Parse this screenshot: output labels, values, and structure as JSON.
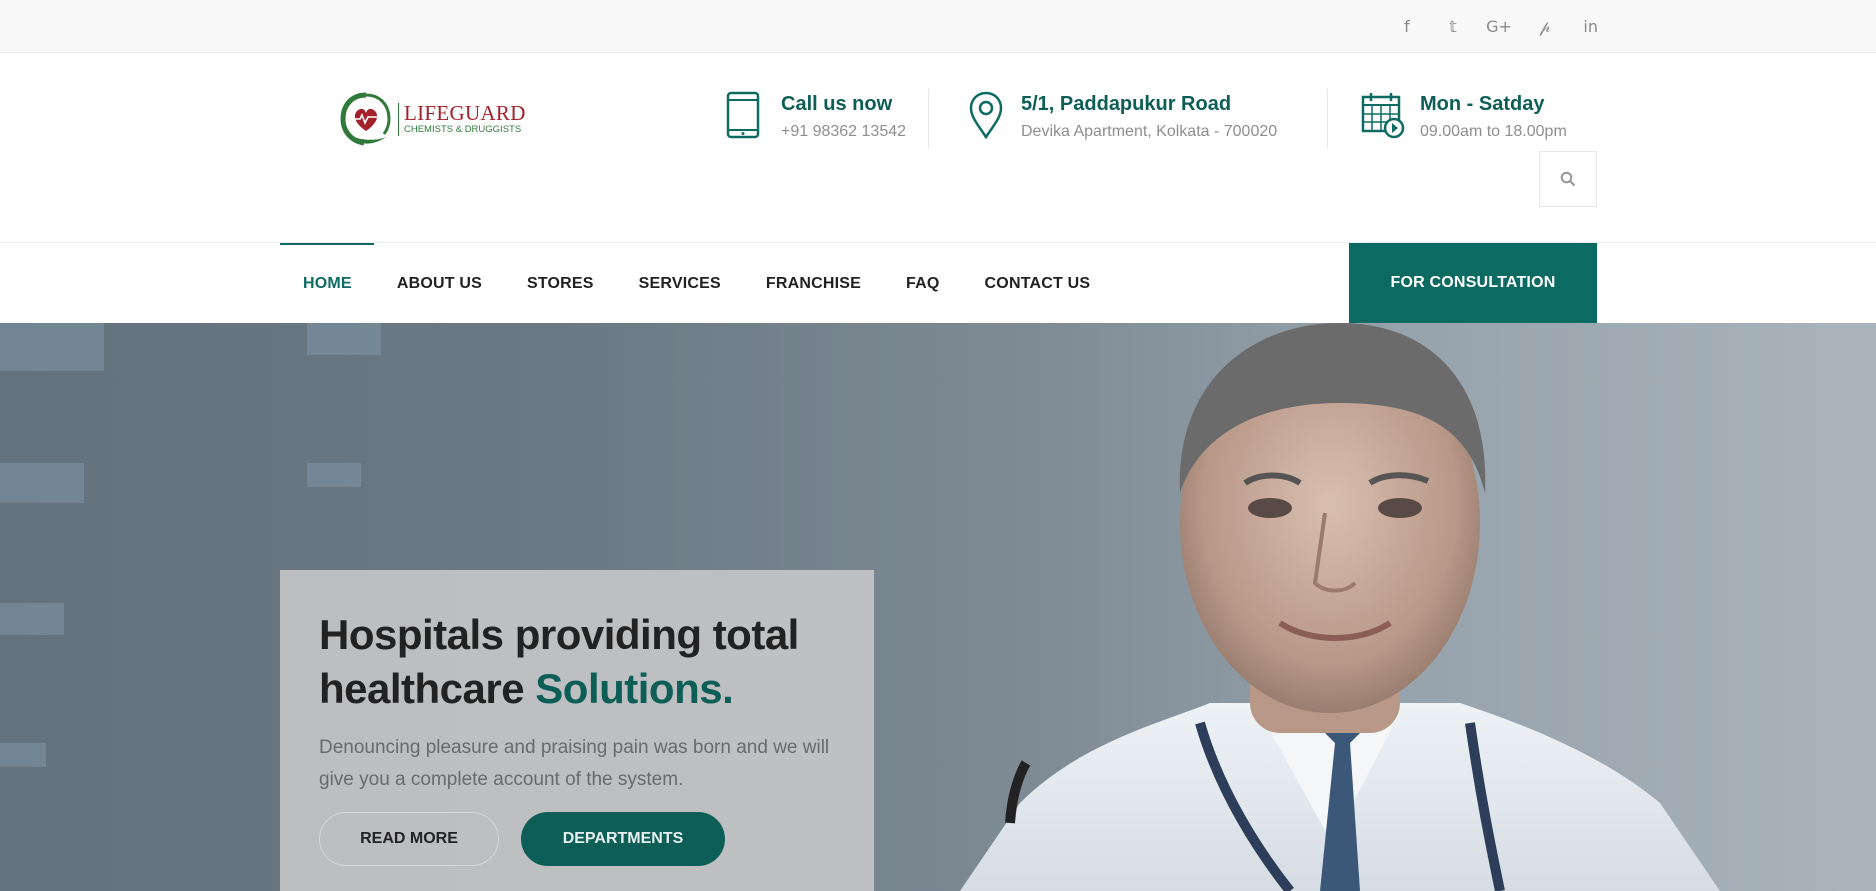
{
  "social": {
    "items": [
      {
        "icon": "facebook-icon",
        "glyph": "f"
      },
      {
        "icon": "twitter-icon",
        "glyph": "𝕥"
      },
      {
        "icon": "google-plus-icon",
        "glyph": "G+"
      },
      {
        "icon": "pinterest-icon",
        "glyph": "𝓅"
      },
      {
        "icon": "linkedin-icon",
        "glyph": "in"
      }
    ]
  },
  "logo": {
    "name": "LIFEGUARD",
    "tagline": "CHEMISTS & DRUGGISTS"
  },
  "contact": {
    "phone": {
      "title": "Call us now",
      "value": "+91 98362 13542",
      "icon": "phone-icon"
    },
    "address": {
      "title": "5/1, Paddapukur Road",
      "value": "Devika Apartment, Kolkata - 700020",
      "icon": "location-pin-icon"
    },
    "hours": {
      "title": "Mon - Satday",
      "value": "09.00am to 18.00pm",
      "icon": "calendar-clock-icon"
    }
  },
  "search": {
    "icon": "search-icon"
  },
  "nav": {
    "items": [
      {
        "label": "HOME",
        "active": true
      },
      {
        "label": "ABOUT US"
      },
      {
        "label": "STORES"
      },
      {
        "label": "SERVICES"
      },
      {
        "label": "FRANCHISE"
      },
      {
        "label": "FAQ"
      },
      {
        "label": "CONTACT US"
      }
    ],
    "cta_label": "FOR CONSULTATION"
  },
  "hero": {
    "title_part1": "Hospitals providing total healthcare",
    "title_accent": "Solutions.",
    "description": "Denouncing pleasure and praising pain was born and we will give you a complete account of the system.",
    "btn_read_more": "READ MORE",
    "btn_departments": "DEPARTMENTS"
  },
  "colors": {
    "brand_teal": "#0b6b62",
    "accent_teal": "#0d5e57",
    "logo_red": "#a3212a",
    "logo_green": "#2f7a3b"
  }
}
